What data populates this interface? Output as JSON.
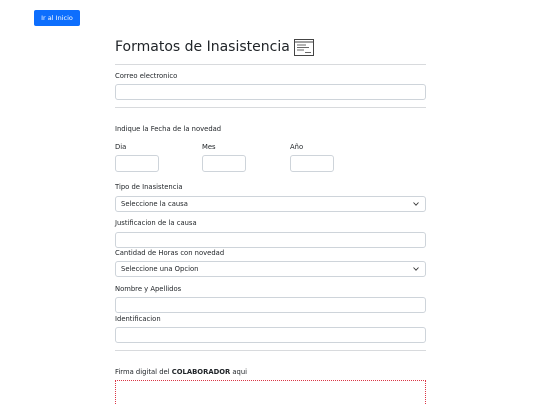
{
  "nav": {
    "home_label": "Ir al Inicio"
  },
  "form": {
    "title": "Formatos de Inasistencia",
    "email_label": "Correo electronico",
    "date_prompt": "Indique la Fecha de la novedad",
    "day_label": "Dia",
    "month_label": "Mes",
    "year_label": "Año",
    "type_label": "Tipo de Inasistencia",
    "type_selected": "Seleccione la causa",
    "justification_label": "Justificacion de la causa",
    "hours_label": "Cantidad de Horas con novedad",
    "hours_selected": "Seleccione una Opcion",
    "name_label": "Nombre y Apellidos",
    "id_label": "Identificacion",
    "signature_prefix": "Firma digital del ",
    "signature_bold": "COLABORADOR",
    "signature_suffix": " aqui"
  },
  "colors": {
    "primary": "#0d6efd",
    "signature_border": "#dc3545"
  },
  "icons": {
    "title_icon": "form-icon",
    "select_arrow": "chevron-down-icon"
  }
}
